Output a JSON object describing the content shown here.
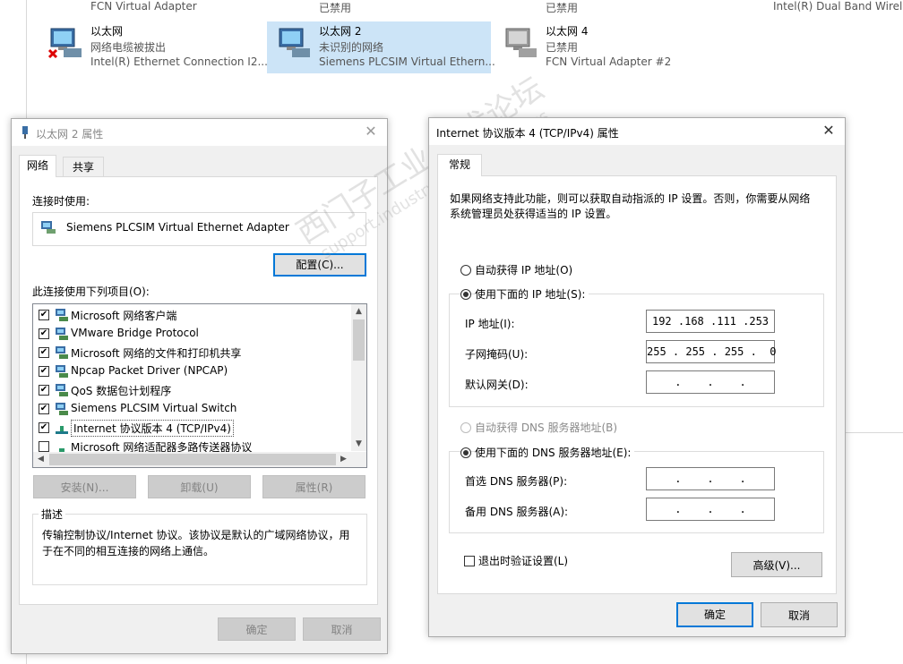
{
  "background": {
    "top_row": [
      "FCN Virtual Adapter",
      "已禁用",
      "已禁用",
      "Intel(R) Dual Band Wirele"
    ],
    "connections": [
      {
        "name": "以太网",
        "status": "网络电缆被拔出",
        "adapter": "Intel(R) Ethernet Connection I2..."
      },
      {
        "name": "以太网 2",
        "status": "未识别的网络",
        "adapter": "Siemens PLCSIM Virtual Ethern..."
      },
      {
        "name": "以太网 4",
        "status": "已禁用",
        "adapter": "FCN Virtual Adapter #2"
      }
    ]
  },
  "props_dialog": {
    "title": "以太网 2 属性",
    "tabs": [
      "网络",
      "共享"
    ],
    "connect_using_label": "连接时使用:",
    "adapter_name": "Siemens PLCSIM Virtual Ethernet Adapter",
    "configure_button": "配置(C)...",
    "items_label": "此连接使用下列项目(O):",
    "items": [
      {
        "label": "Microsoft 网络客户端",
        "checked": true,
        "icon": "network-client-icon"
      },
      {
        "label": "VMware Bridge Protocol",
        "checked": true,
        "icon": "network-client-icon"
      },
      {
        "label": "Microsoft 网络的文件和打印机共享",
        "checked": true,
        "icon": "network-client-icon"
      },
      {
        "label": "Npcap Packet Driver (NPCAP)",
        "checked": true,
        "icon": "network-client-icon"
      },
      {
        "label": "QoS 数据包计划程序",
        "checked": true,
        "icon": "network-client-icon"
      },
      {
        "label": "Siemens PLCSIM Virtual Switch",
        "checked": true,
        "icon": "network-client-icon"
      },
      {
        "label": "Internet 协议版本 4 (TCP/IPv4)",
        "checked": true,
        "icon": "protocol-icon",
        "selected": true
      },
      {
        "label": "Microsoft 网络适配器多路传送器协议",
        "checked": false,
        "icon": "protocol-icon"
      }
    ],
    "install_button": "安装(N)...",
    "uninstall_button": "卸载(U)",
    "properties_button": "属性(R)",
    "description_group": "描述",
    "description_text": "传输控制协议/Internet 协议。该协议是默认的广域网络协议，用于在不同的相互连接的网络上通信。",
    "ok_button": "确定",
    "cancel_button": "取消"
  },
  "ipv4_dialog": {
    "title": "Internet 协议版本 4 (TCP/IPv4) 属性",
    "tab": "常规",
    "intro": "如果网络支持此功能，则可以获取自动指派的 IP 设置。否则，你需要从网络系统管理员处获得适当的 IP 设置。",
    "auto_ip_label": "自动获得 IP 地址(O)",
    "manual_ip_label": "使用下面的 IP 地址(S):",
    "ip_label": "IP 地址(I):",
    "ip_value": "192 .168 .111 .253",
    "subnet_label": "子网掩码(U):",
    "subnet_value": "255 . 255 . 255 .  0",
    "gateway_label": "默认网关(D):",
    "gateway_value": " .    .    . ",
    "auto_dns_label": "自动获得 DNS 服务器地址(B)",
    "manual_dns_label": "使用下面的 DNS 服务器地址(E):",
    "preferred_dns_label": "首选 DNS 服务器(P):",
    "preferred_dns_value": " .    .    . ",
    "alternate_dns_label": "备用 DNS 服务器(A):",
    "alternate_dns_value": " .    .    . ",
    "validate_label": "退出时验证设置(L)",
    "advanced_button": "高级(V)...",
    "ok_button": "确定",
    "cancel_button": "取消"
  },
  "watermark": {
    "line1": "西门子工业 技术论坛",
    "line2": "support.industry.siemens.com/cs"
  }
}
